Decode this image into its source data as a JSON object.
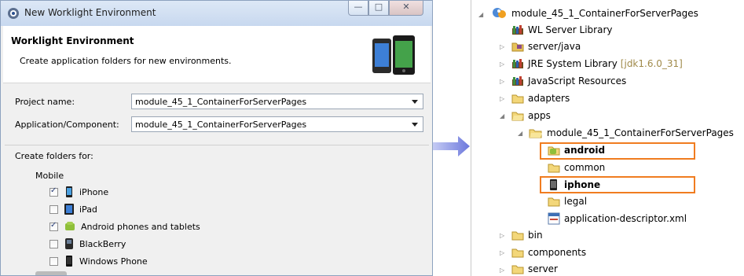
{
  "dialog": {
    "title": "New Worklight Environment",
    "header_title": "Worklight Environment",
    "header_desc": "Create application folders for new environments.",
    "project_label": "Project name:",
    "project_value": "module_45_1_ContainerForServerPages",
    "app_label": "Application/Component:",
    "app_value": "module_45_1_ContainerForServerPages",
    "create_label": "Create folders for:",
    "mobile_label": "Mobile",
    "options": [
      {
        "label": "iPhone",
        "checked": true,
        "icon": "iphone-icon"
      },
      {
        "label": "iPad",
        "checked": false,
        "icon": "ipad-icon"
      },
      {
        "label": "Android phones and tablets",
        "checked": true,
        "icon": "android-icon"
      },
      {
        "label": "BlackBerry",
        "checked": false,
        "icon": "blackberry-icon"
      },
      {
        "label": "Windows Phone",
        "checked": false,
        "icon": "windows-phone-icon"
      }
    ]
  },
  "tree": {
    "project": "module_45_1_ContainerForServerPages",
    "wl_server_library": "WL Server Library",
    "server_java": "server/java",
    "jre_library": "JRE System Library",
    "jre_version": "[jdk1.6.0_31]",
    "js_resources": "JavaScript Resources",
    "adapters": "adapters",
    "apps": "apps",
    "app_folder": "module_45_1_ContainerForServerPages",
    "android": "android",
    "common": "common",
    "iphone": "iphone",
    "legal": "legal",
    "descriptor": "application-descriptor.xml",
    "bin": "bin",
    "components": "components",
    "server": "server"
  },
  "colors": {
    "highlight": "#f07c20",
    "arrow": "#7b86e0"
  }
}
